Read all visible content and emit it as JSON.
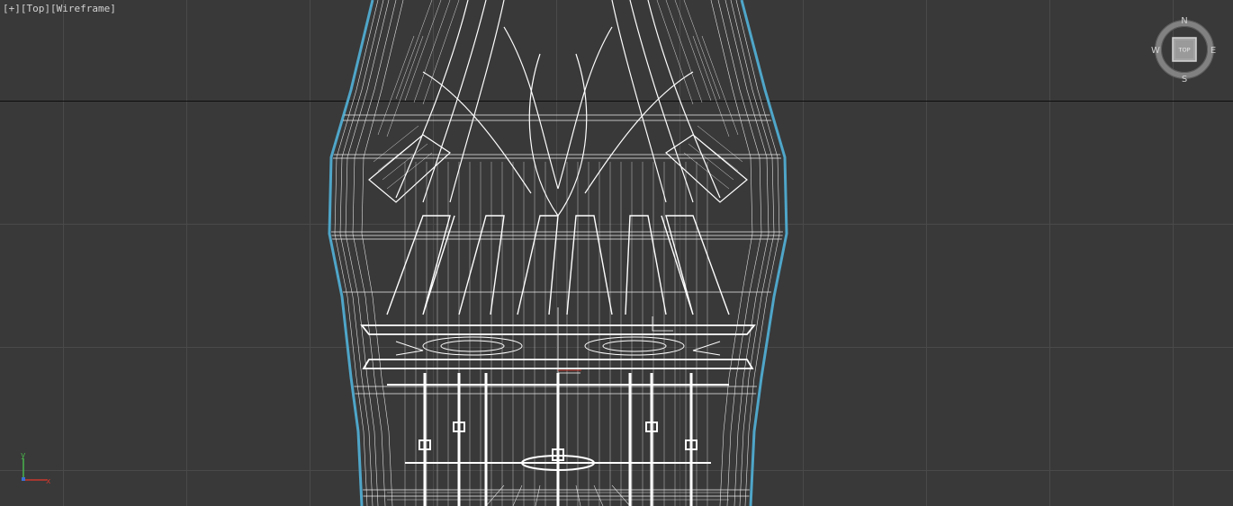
{
  "viewport": {
    "label_plus": "[+]",
    "label_view": "[Top]",
    "label_shading": "[Wireframe]"
  },
  "viewcube": {
    "face_label": "TOP",
    "north": "N",
    "south": "S",
    "east": "E",
    "west": "W"
  },
  "tripod": {
    "y_label": "y",
    "x_label": "x"
  },
  "colors": {
    "background": "#393939",
    "grid": "#4a4a4a",
    "home_grid_axis": "#0d0d0d",
    "wire": "#ffffff",
    "selection_outline": "#4fa6c9",
    "axis_x": "#c8382e",
    "axis_y": "#49b24a"
  }
}
